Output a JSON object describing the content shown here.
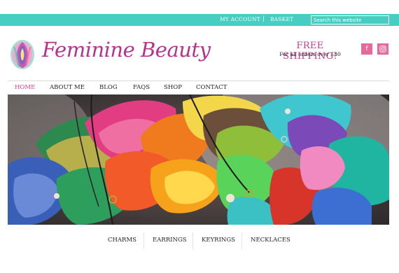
{
  "topbar": {
    "my_account": "MY ACCOUNT",
    "separator": "|",
    "basket": "BASKET",
    "search_placeholder": "Search this website"
  },
  "brand": {
    "name": "Feminine Beauty"
  },
  "shipping": {
    "title": "FREE SHIPPING!",
    "subtitle": "For all orders over £30"
  },
  "social": {
    "facebook_glyph": "f",
    "instagram_icon": "instagram-icon"
  },
  "nav": {
    "items": [
      {
        "label": "HOME",
        "active": true
      },
      {
        "label": "ABOUT ME",
        "active": false
      },
      {
        "label": "BLOG",
        "active": false
      },
      {
        "label": "FAQS",
        "active": false
      },
      {
        "label": "SHOP",
        "active": false
      },
      {
        "label": "CONTACT",
        "active": false
      }
    ]
  },
  "categories": [
    "CHARMS",
    "EARRINGS",
    "KEYRINGS",
    "NECKLACES"
  ],
  "colors": {
    "topbar": "#48cdc3",
    "brand_pink": "#b7318d",
    "nav_active": "#d2418f",
    "social_bg": "#e56a9c"
  }
}
